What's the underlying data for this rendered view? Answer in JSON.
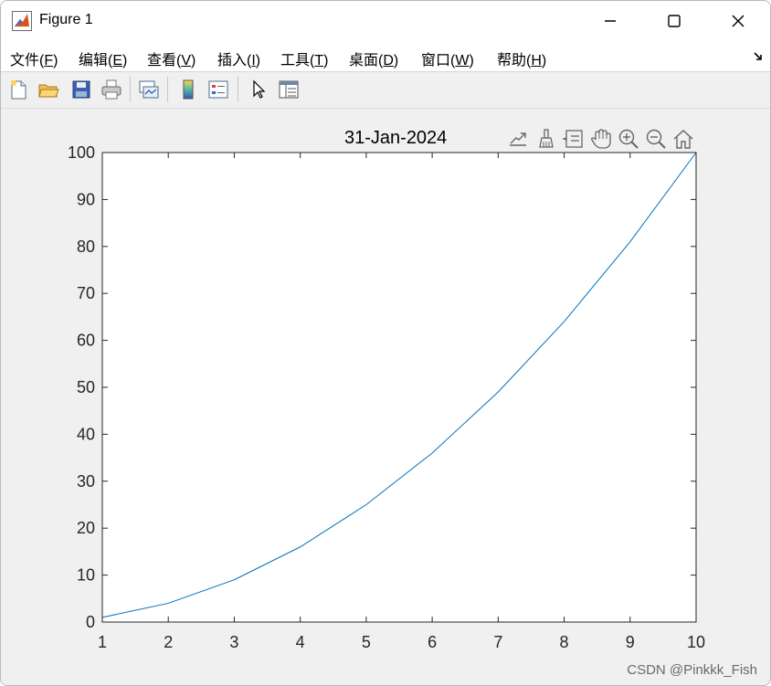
{
  "window": {
    "title": "Figure 1",
    "menu": [
      {
        "label": "文件(",
        "key": "F",
        "end": ")"
      },
      {
        "label": "编辑(",
        "key": "E",
        "end": ")"
      },
      {
        "label": "查看(",
        "key": "V",
        "end": ")"
      },
      {
        "label": "插入(",
        "key": "I",
        "end": ")"
      },
      {
        "label": "工具(",
        "key": "T",
        "end": ")"
      },
      {
        "label": "桌面(",
        "key": "D",
        "end": ")"
      },
      {
        "label": "窗口(",
        "key": "W",
        "end": ")"
      },
      {
        "label": "帮助(",
        "key": "H",
        "end": ")"
      }
    ]
  },
  "toolbar": {
    "icons": [
      "new-figure-icon",
      "open-file-icon",
      "save-icon",
      "print-icon",
      "link-plot-icon",
      "colorbar-icon",
      "legend-icon",
      "edit-plot-arrow-icon",
      "property-inspector-icon"
    ]
  },
  "axes_toolbar": {
    "icons": [
      "export-icon",
      "brush-icon",
      "data-tips-icon",
      "pan-icon",
      "zoom-in-icon",
      "zoom-out-icon",
      "home-icon"
    ]
  },
  "chart_data": {
    "type": "line",
    "title": "31-Jan-2024",
    "xlabel": "",
    "ylabel": "",
    "x": [
      1,
      2,
      3,
      4,
      5,
      6,
      7,
      8,
      9,
      10
    ],
    "series": [
      {
        "values": [
          1,
          4,
          9,
          16,
          25,
          36,
          49,
          64,
          81,
          100
        ],
        "color": "#0072bd"
      }
    ],
    "xlim": [
      1,
      10
    ],
    "ylim": [
      0,
      100
    ],
    "xticks": [
      "1",
      "2",
      "3",
      "4",
      "5",
      "6",
      "7",
      "8",
      "9",
      "10"
    ],
    "yticks": [
      "0",
      "10",
      "20",
      "30",
      "40",
      "50",
      "60",
      "70",
      "80",
      "90",
      "100"
    ],
    "grid": false
  },
  "watermark": "CSDN @Pinkkk_Fish"
}
